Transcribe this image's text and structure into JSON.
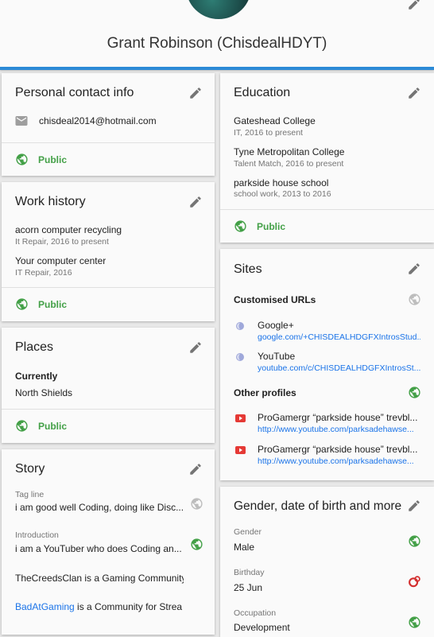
{
  "header": {
    "name": "Grant Robinson (ChisdealHDYT)"
  },
  "contact": {
    "title": "Personal contact info",
    "email": "chisdeal2014@hotmail.com",
    "visibility": "Public"
  },
  "work": {
    "title": "Work history",
    "items": [
      {
        "name": "acorn computer recycling",
        "detail": "It Repair, 2016 to present"
      },
      {
        "name": "Your computer center",
        "detail": "IT Repair, 2016"
      }
    ],
    "visibility": "Public"
  },
  "places": {
    "title": "Places",
    "currently_label": "Currently",
    "current": "North Shields",
    "visibility": "Public"
  },
  "story": {
    "title": "Story",
    "tagline_label": "Tag line",
    "tagline": "i am good well Coding, doing like Disc...",
    "intro_label": "Introduction",
    "intro": "i am a YouTuber who does Coding an...",
    "para1": "TheCreedsClan is a Gaming Community",
    "para2_link": "BadAtGaming",
    "para2_rest": " is a Community for Strea"
  },
  "education": {
    "title": "Education",
    "items": [
      {
        "name": "Gateshead College",
        "detail": "IT, 2016 to present"
      },
      {
        "name": "Tyne Metropolitan College",
        "detail": "Talent Match, 2016 to present"
      },
      {
        "name": "parkside house school",
        "detail": "school work, 2013 to 2016"
      }
    ],
    "visibility": "Public"
  },
  "sites": {
    "title": "Sites",
    "custom_label": "Customised URLs",
    "urls": [
      {
        "name": "Google+",
        "url": "google.com/+CHISDEALHDGFXIntrosStud..."
      },
      {
        "name": "YouTube",
        "url": "youtube.com/c/CHISDEALHDGFXIntrosSt..."
      }
    ],
    "other_label": "Other profiles",
    "profiles": [
      {
        "name": "ProGamergr “parkside house” trevbl...",
        "url": "http://www.youtube.com/parksadehawse..."
      },
      {
        "name": "ProGamergr “parkside house” trevbl...",
        "url": "http://www.youtube.com/parksadehawse..."
      }
    ]
  },
  "basics": {
    "title": "Gender, date of birth and more",
    "gender_label": "Gender",
    "gender": "Male",
    "birthday_label": "Birthday",
    "birthday": "25 Jun",
    "occupation_label": "Occupation",
    "occupation": "Development"
  },
  "colors": {
    "accent": "#2c8ad6",
    "public": "#43a047",
    "link": "#1a73e8",
    "youtube": "#e53935",
    "circles": "#d32f2f"
  }
}
